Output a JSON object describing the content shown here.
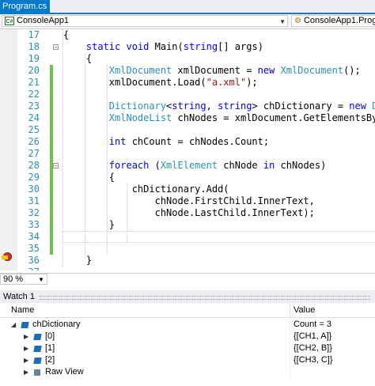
{
  "tab": {
    "label": "Program.cs",
    "close": "×"
  },
  "navbar": {
    "left": "ConsoleApp1",
    "right": "ConsoleApp1.Prog",
    "left_icon": "C#",
    "right_icon": "class-icon"
  },
  "editor": {
    "lines": [
      {
        "n": "17",
        "html": "    {"
      },
      {
        "n": "18",
        "html": "        <span class=\"kw\">static</span> <span class=\"kw\">void</span> Main(<span class=\"kw\">string</span>[] args)"
      },
      {
        "n": "19",
        "html": "        {"
      },
      {
        "n": "20",
        "html": "            <span class=\"ty\">XmlDocument</span> xmlDocument = <span class=\"kw\">new</span> <span class=\"ty\">XmlDocument</span>();"
      },
      {
        "n": "21",
        "html": "            xmlDocument.Load(<span class=\"st\">\"a.xml\"</span>);"
      },
      {
        "n": "22",
        "html": ""
      },
      {
        "n": "23",
        "html": "            <span class=\"ty\">Dictionary</span>&lt;<span class=\"kw\">string</span>, <span class=\"kw\">string</span>&gt; chDictionary = <span class=\"kw\">new</span> <span class=\"ty\">Dic</span>"
      },
      {
        "n": "24",
        "html": "            <span class=\"ty\">XmlNodeList</span> chNodes = xmlDocument.GetElementsByTa"
      },
      {
        "n": "25",
        "html": ""
      },
      {
        "n": "26",
        "html": "            <span class=\"kw\">int</span> chCount = chNodes.Count;"
      },
      {
        "n": "27",
        "html": ""
      },
      {
        "n": "28",
        "html": "            <span class=\"kw\">foreach</span> (<span class=\"ty\">XmlElement</span> chNode <span class=\"kw\">in</span> chNodes)"
      },
      {
        "n": "29",
        "html": "            {"
      },
      {
        "n": "30",
        "html": "                chDictionary.Add("
      },
      {
        "n": "31",
        "html": "                    chNode.FirstChild.InnerText,"
      },
      {
        "n": "32",
        "html": "                    chNode.LastChild.InnerText);"
      },
      {
        "n": "33",
        "html": "            }"
      },
      {
        "n": "34",
        "html": ""
      },
      {
        "n": "35",
        "html": ""
      },
      {
        "n": "36",
        "html": "        }"
      },
      {
        "n": "37",
        "html": ""
      }
    ]
  },
  "zoom": {
    "label": "90 %"
  },
  "watch": {
    "title": "Watch 1",
    "col_name": "Name",
    "col_value": "Value",
    "rows": [
      {
        "name": "chDictionary",
        "value": "Count = 3"
      },
      {
        "name": "[0]",
        "value": "{[CH1, A]}"
      },
      {
        "name": "[1]",
        "value": "{[CH2, B]}"
      },
      {
        "name": "[2]",
        "value": "{[CH3, C]}"
      },
      {
        "name": "Raw View",
        "value": ""
      }
    ]
  },
  "colors": {
    "accent": "#007acc",
    "keyword": "#0000ff",
    "type": "#2b91af",
    "string": "#a31515",
    "change": "#6cc24a",
    "breakpoint": "#c8332c"
  }
}
